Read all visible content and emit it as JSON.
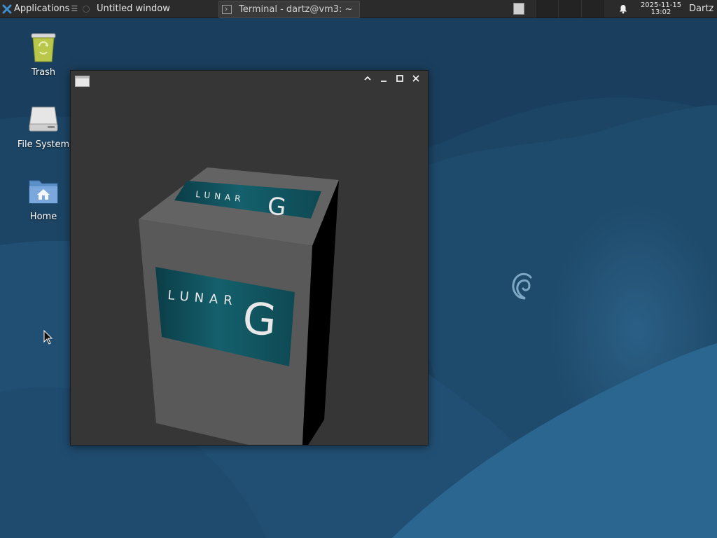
{
  "panel": {
    "apps_label": "Applications",
    "tasks": [
      {
        "label": "Untitled window"
      },
      {
        "label": "Terminal - dartz@vm3: ~"
      }
    ],
    "clock_date": "2025-11-15",
    "clock_time": "13:02",
    "user": "Dartz"
  },
  "desktop": {
    "icons": [
      {
        "label": "Trash",
        "icon": "trash-icon"
      },
      {
        "label": "File System",
        "icon": "drive-icon"
      },
      {
        "label": "Home",
        "icon": "home-folder-icon"
      }
    ]
  },
  "window": {
    "cube_texture_text": "LUNAR",
    "cube_texture_letter": "G"
  },
  "colors": {
    "panel_bg": "#2b2b2b",
    "desktop_bg": "#1e4a6b",
    "window_bg": "#363636",
    "texture_teal": "#0f4f5a"
  }
}
